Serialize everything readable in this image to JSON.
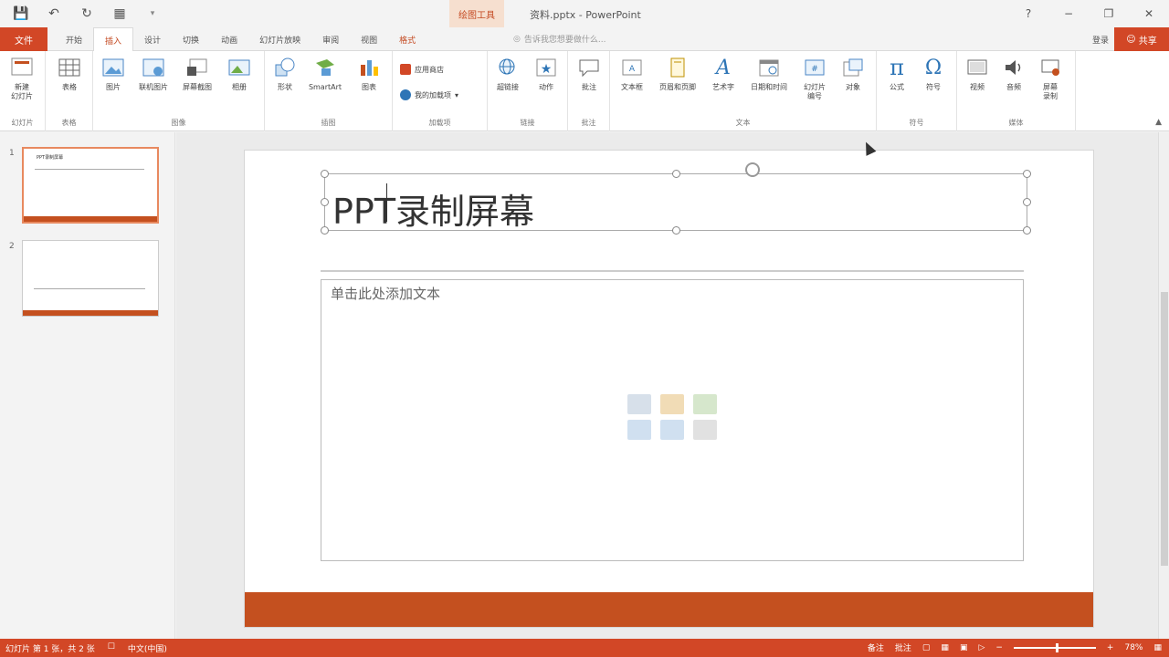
{
  "window": {
    "doc_title": "资料.pptx - PowerPoint",
    "context_tools": "绘图工具",
    "controls": [
      "?",
      "−",
      "❐",
      "✕"
    ]
  },
  "tabs": {
    "file": "文件",
    "items": [
      "开始",
      "插入",
      "设计",
      "切换",
      "动画",
      "幻灯片放映",
      "审阅",
      "视图",
      "格式"
    ],
    "active_index": 1,
    "tell_me": "告诉我您想要做什么...",
    "sign_in": "登录",
    "share": "共享"
  },
  "ribbon": {
    "groups": [
      {
        "label": "幻灯片",
        "buttons": [
          "新建\n幻灯片"
        ]
      },
      {
        "label": "表格",
        "buttons": [
          "表格"
        ]
      },
      {
        "label": "图像",
        "buttons": [
          "图片",
          "联机图片",
          "屏幕截图",
          "相册"
        ]
      },
      {
        "label": "插图",
        "buttons": [
          "形状",
          "SmartArt",
          "图表"
        ]
      },
      {
        "label": "加载项",
        "buttons": [
          "应用商店",
          "我的加载项"
        ]
      },
      {
        "label": "链接",
        "buttons": [
          "超链接",
          "动作"
        ]
      },
      {
        "label": "批注",
        "buttons": [
          "批注"
        ]
      },
      {
        "label": "文本",
        "buttons": [
          "文本框",
          "页眉和页脚",
          "艺术字",
          "日期和时间",
          "幻灯片\n编号",
          "对象"
        ]
      },
      {
        "label": "符号",
        "buttons": [
          "公式",
          "符号"
        ]
      },
      {
        "label": "媒体",
        "buttons": [
          "视频",
          "音频",
          "屏幕\n录制"
        ]
      }
    ]
  },
  "thumbnails": [
    {
      "num": "1",
      "title": "PPT录制屏幕",
      "selected": true
    },
    {
      "num": "2",
      "title": "",
      "selected": false
    }
  ],
  "slide": {
    "title": "PPT录制屏幕",
    "content_placeholder": "单击此处添加文本"
  },
  "status": {
    "slide_info": "幻灯片 第 1 张，共 2 张",
    "language": "中文(中国)",
    "notes": "备注",
    "comments": "批注",
    "zoom": "78%"
  },
  "colors": {
    "accent": "#d24726",
    "slide_footer": "#c4501f"
  }
}
